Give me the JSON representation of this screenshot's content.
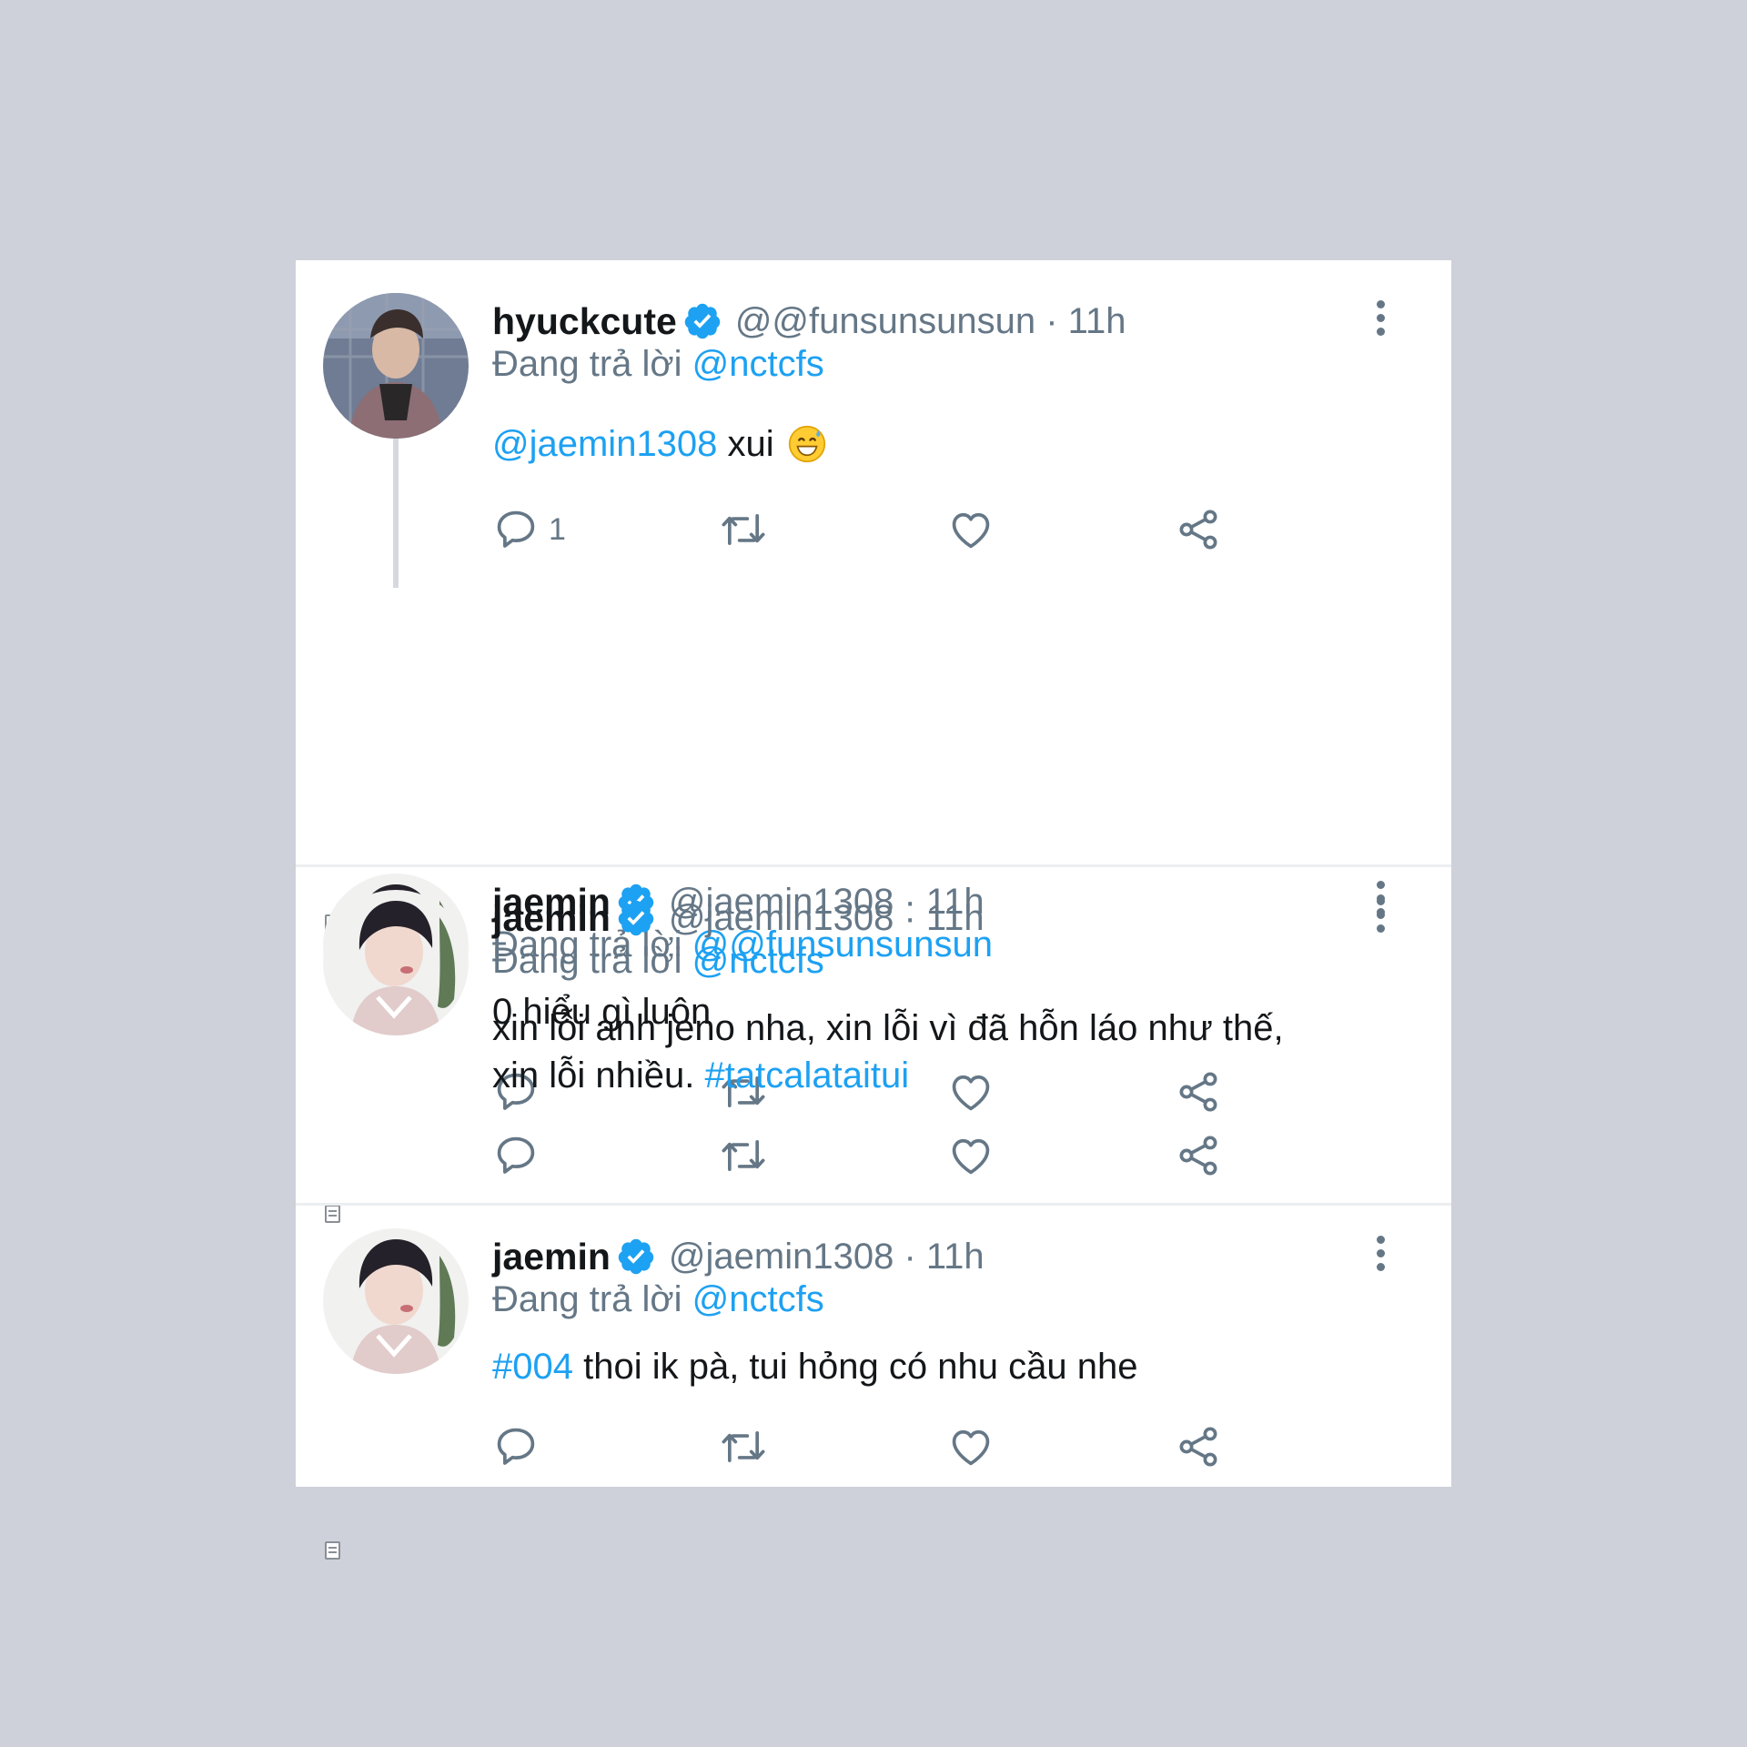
{
  "colors": {
    "background": "#CED1DA",
    "card": "#FFFFFF",
    "link": "#1DA1F2",
    "secondary_text": "#657786",
    "verified": "#1DA1F2"
  },
  "tweets": [
    {
      "name": "hyuckcute",
      "handle": "@@funsunsunsun",
      "time": "· 11h",
      "reply_prefix": "Đang trả lời",
      "reply_target": "@nctcfs",
      "body": {
        "mention": "@jaemin1308",
        "text": " xui",
        "emoji": "grinning-face-with-sweat-emoji"
      },
      "reply_count": "1",
      "avatar": "avatar-hyuckcute"
    },
    {
      "name": "jaemin",
      "handle": "@jaemin1308",
      "time": "· 11h",
      "reply_prefix": "Đang trả lời",
      "reply_target": "@@funsunsunsun",
      "body": {
        "text": "0 hiểu gì luôn"
      },
      "avatar": "avatar-jaemin"
    },
    {
      "name": "jaemin",
      "handle": "@jaemin1308",
      "time": "· 11h",
      "reply_prefix": "Đang trả lời",
      "reply_target": "@nctcfs",
      "body": {
        "line1": "xin lỗi anh jeno nha, xin lỗi vì đã hỗn láo như thế,",
        "line2": "xin lỗi nhiều. ",
        "hashtag": "#tatcalataitui"
      },
      "avatar": "avatar-jaemin"
    },
    {
      "name": "jaemin",
      "handle": "@jaemin1308",
      "time": "· 11h",
      "reply_prefix": "Đang trả lời",
      "reply_target": "@nctcfs",
      "body": {
        "hashtag": "#004",
        "text": " thoi ik pà, tui hỏng có nhu cầu nhe"
      },
      "avatar": "avatar-jaemin"
    }
  ],
  "action_icons": [
    "reply-icon",
    "retweet-icon",
    "like-icon",
    "share-icon"
  ]
}
